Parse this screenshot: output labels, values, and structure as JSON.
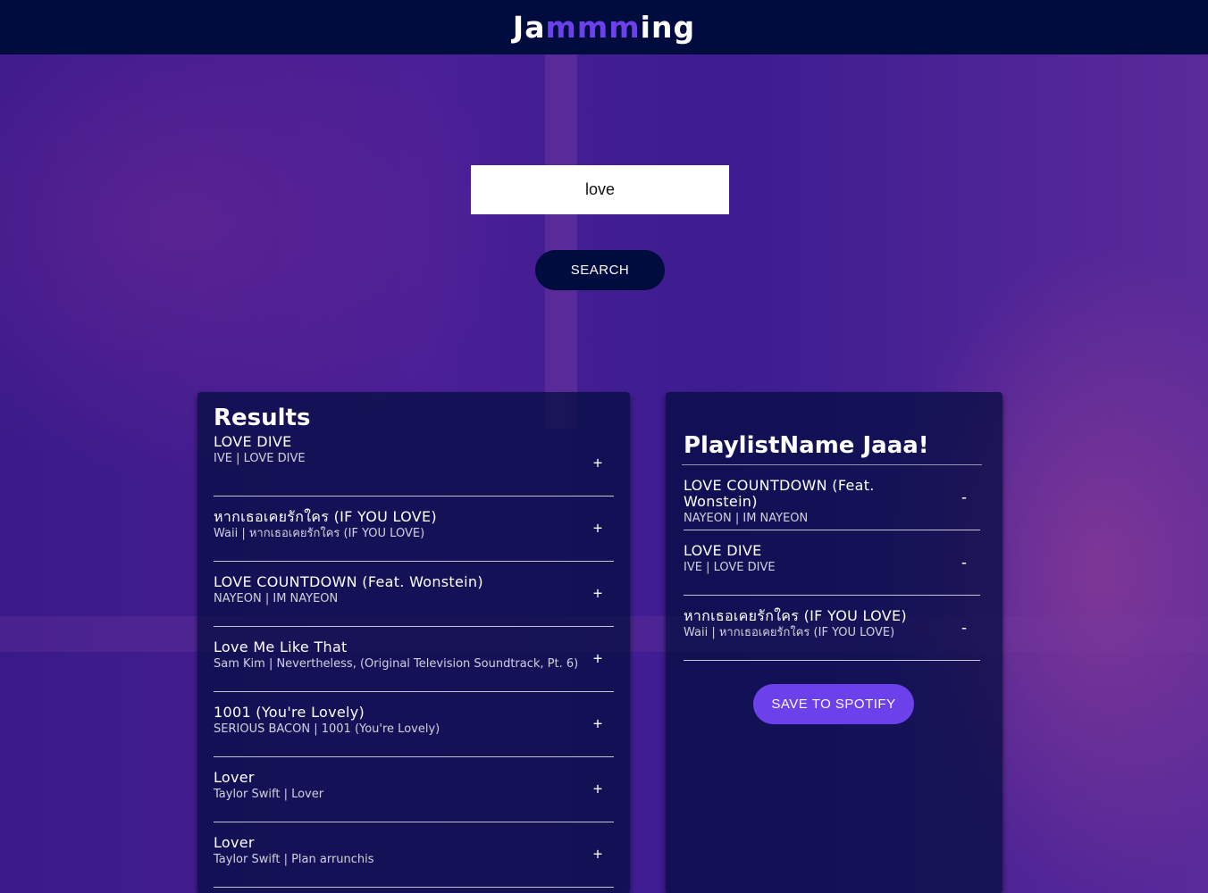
{
  "header": {
    "logo_prefix": "Ja",
    "logo_accent": "mmm",
    "logo_suffix": "ing",
    "accent_color": "#6c41ec",
    "background_color": "#010c3e"
  },
  "search": {
    "value": "love",
    "button_label": "SEARCH"
  },
  "results": {
    "title": "Results",
    "tracks": [
      {
        "name": "LOVE DIVE",
        "info": "IVE | LOVE DIVE",
        "action": "+"
      },
      {
        "name": "หากเธอเคยรักใคร (IF YOU LOVE)",
        "info": "Waii | หากเธอเคยรักใคร (IF YOU LOVE)",
        "action": "+"
      },
      {
        "name": "LOVE COUNTDOWN (Feat. Wonstein)",
        "info": "NAYEON | IM NAYEON",
        "action": "+"
      },
      {
        "name": "Love Me Like That",
        "info": "Sam Kim | Nevertheless, (Original Television Soundtrack, Pt. 6)",
        "action": "+"
      },
      {
        "name": "1001 (You're Lovely)",
        "info": "SERIOUS BACON | 1001 (You're Lovely)",
        "action": "+"
      },
      {
        "name": "Lover",
        "info": "Taylor Swift | Lover",
        "action": "+"
      },
      {
        "name": "Lover",
        "info": "Taylor Swift | Plan arrunchis",
        "action": "+"
      }
    ]
  },
  "playlist": {
    "name": "PlaylistName Jaaa!",
    "tracks": [
      {
        "name": "LOVE COUNTDOWN (Feat. Wonstein)",
        "info": "NAYEON | IM NAYEON",
        "action": "-"
      },
      {
        "name": "LOVE DIVE",
        "info": "IVE | LOVE DIVE",
        "action": "-"
      },
      {
        "name": "หากเธอเคยรักใคร (IF YOU LOVE)",
        "info": "Waii | หากเธอเคยรักใคร (IF YOU LOVE)",
        "action": "-"
      }
    ],
    "save_label": "SAVE TO SPOTIFY"
  }
}
